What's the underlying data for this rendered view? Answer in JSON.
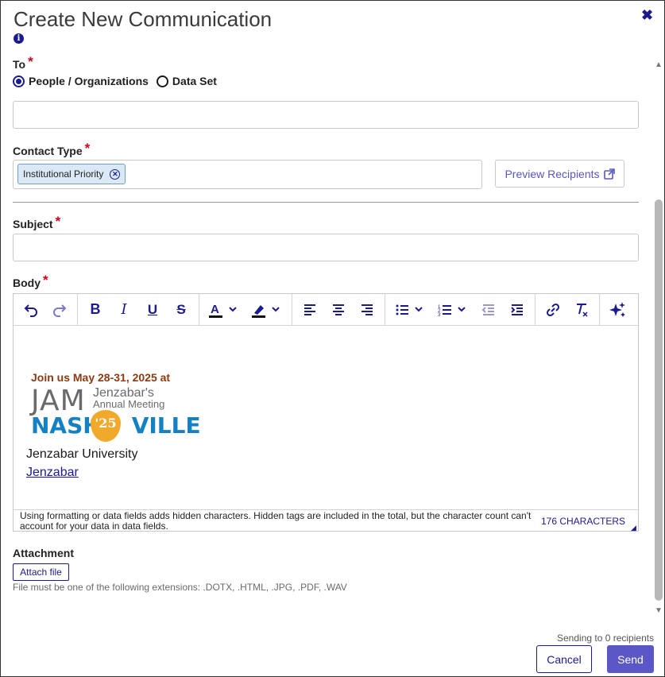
{
  "dialog": {
    "title": "Create New Communication",
    "close_glyph": "✖"
  },
  "to": {
    "label": "To",
    "required": "*",
    "options": [
      "People / Organizations",
      "Data Set"
    ],
    "selected": "People / Organizations",
    "value": ""
  },
  "contact_type": {
    "label": "Contact Type",
    "required": "*",
    "chips": [
      "Institutional Priority"
    ],
    "preview_label": "Preview Recipients"
  },
  "subject": {
    "label": "Subject",
    "required": "*",
    "value": ""
  },
  "body": {
    "label": "Body",
    "required": "*",
    "toolbar": {
      "history": [
        "undo-icon",
        "redo-icon"
      ],
      "format": [
        "bold-icon",
        "italic-icon",
        "underline-icon",
        "strikethrough-icon"
      ],
      "colors": [
        "font-color-icon",
        "highlight-icon"
      ],
      "align": [
        "align-left-icon",
        "align-center-icon",
        "align-right-icon"
      ],
      "lists": [
        "bullet-list-icon",
        "numbered-list-icon",
        "outdent-icon",
        "indent-icon"
      ],
      "insert": [
        "link-icon",
        "clear-format-icon"
      ],
      "ai": [
        "ai-sparkle-icon"
      ]
    },
    "content": {
      "banner_join": "Join us May 28-31, 2025 at",
      "banner_jam": "JAM",
      "banner_jenzabars": "Jenzabar's",
      "banner_annual": "Annual Meeting",
      "banner_nash": "NASH",
      "banner_year": "'25",
      "banner_ville": "VILLE",
      "university": "Jenzabar University",
      "link_text": "Jenzabar"
    },
    "counter_note": "Using formatting or data fields adds hidden characters. Hidden tags are included in the total, but the character count can't account for your data in data fields.",
    "counter_value": "176 CHARACTERS"
  },
  "attachment": {
    "label": "Attachment",
    "button": "Attach file",
    "hint": "File must be one of the following extensions: .DOTX, .HTML, .JPG, .PDF, .WAV"
  },
  "footer": {
    "sending": "Sending to 0 recipients",
    "cancel": "Cancel",
    "send": "Send"
  },
  "colors": {
    "accent": "#1b1b8f",
    "primary_button": "#5b57c6",
    "required": "#d0021b",
    "chip_bg": "#dbe9f7",
    "banner_orange": "#8b3a12",
    "banner_blue": "#1580c2",
    "banner_pick": "#f0a92a"
  }
}
